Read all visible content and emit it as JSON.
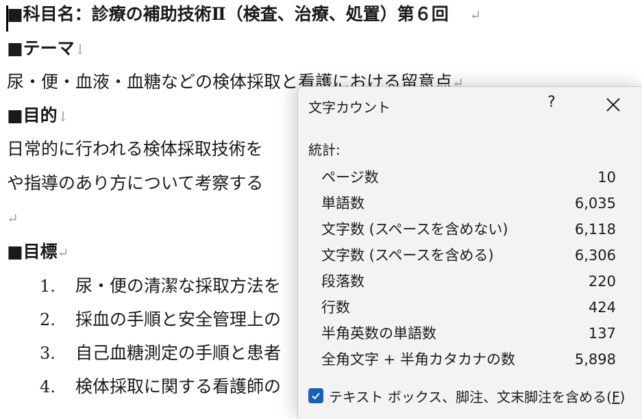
{
  "document": {
    "heading": "■科目名：診療の補助技術Ⅱ（検査、治療、処置）第６回",
    "return_mark": "↵",
    "down_mark": "↓",
    "theme_heading": "■テーマ",
    "theme_text": "尿・便・血液・血糖などの検体採取と看護における留意点",
    "purpose_heading": "■目的",
    "purpose_line1": "日常的に行われる検体採取技術を",
    "purpose_line2": "や指導のあり方について考察する",
    "goal_heading": "■目標",
    "goals": [
      {
        "num": "1.",
        "text": "尿・便の清潔な採取方法を"
      },
      {
        "num": "2.",
        "text": "採血の手順と安全管理上の"
      },
      {
        "num": "3.",
        "text": "自己血糖測定の手順と患者"
      },
      {
        "num": "4.",
        "text": "検体採取に関する看護師の"
      }
    ]
  },
  "dialog": {
    "title": "文字カウント",
    "help_label": "?",
    "section_label": "統計:",
    "stats": [
      {
        "label": "ページ数",
        "value": "10"
      },
      {
        "label": "単語数",
        "value": "6,035"
      },
      {
        "label": "文字数 (スペースを含めない)",
        "value": "6,118"
      },
      {
        "label": "文字数 (スペースを含める)",
        "value": "6,306"
      },
      {
        "label": "段落数",
        "value": "220"
      },
      {
        "label": "行数",
        "value": "424"
      },
      {
        "label": "半角英数の単語数",
        "value": "137"
      },
      {
        "label": "全角文字 + 半角カタカナの数",
        "value": "5,898"
      }
    ],
    "checkbox_label": "テキスト ボックス、脚注、文末脚注を含める(",
    "checkbox_key": "F",
    "checkbox_close": ")",
    "checkbox_checked": true,
    "accent_color": "#1c5fb8"
  }
}
